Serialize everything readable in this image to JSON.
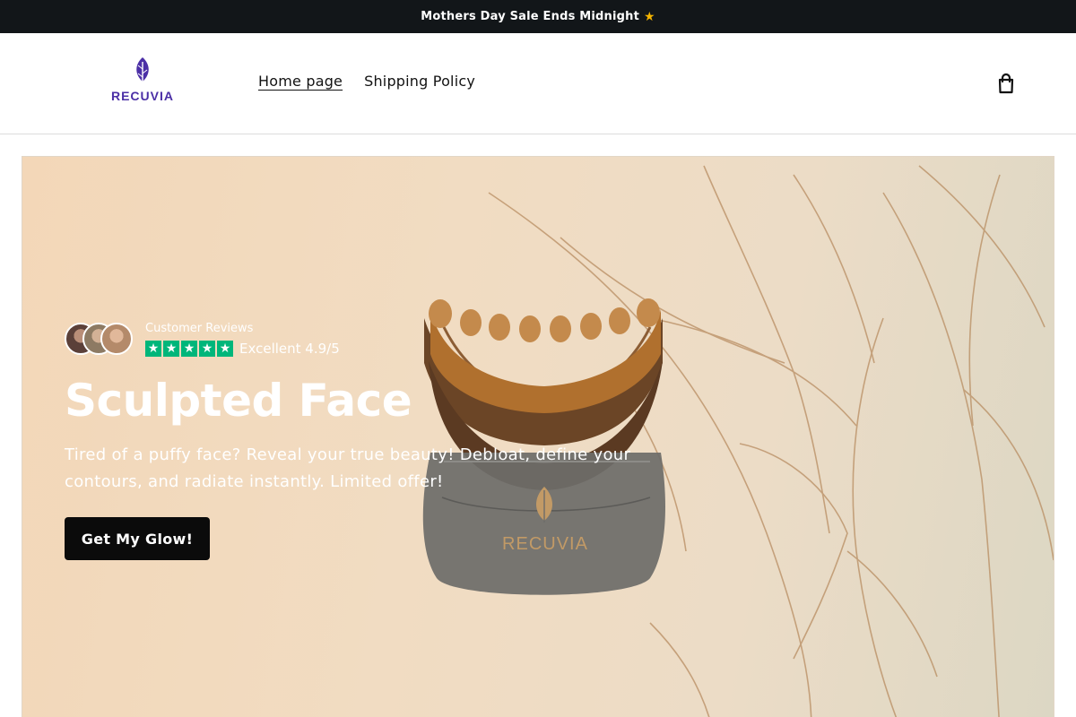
{
  "announcement": {
    "text": "Mothers Day Sale Ends Midnight",
    "icon": "star-icon"
  },
  "header": {
    "logo_text": "RECUVIA",
    "nav": [
      {
        "label": "Home page",
        "active": true
      },
      {
        "label": "Shipping Policy",
        "active": false
      }
    ],
    "cart_icon": "shopping-bag-icon"
  },
  "hero": {
    "reviews_label": "Customer Reviews",
    "rating_text": "Excellent 4.9/5",
    "star_count": 5,
    "title": "Sculpted Face",
    "subtitle": "Tired of a puffy face? Reveal your true beauty! Debloat, define your contours, and radiate instantly. Limited offer!",
    "cta_label": "Get My Glow!",
    "product_brand": "RECUVIA"
  },
  "colors": {
    "announcement_bg": "#121619",
    "brand_purple": "#4b2fa6",
    "star_green": "#00b67a",
    "cta_bg": "#0b0b0b"
  }
}
